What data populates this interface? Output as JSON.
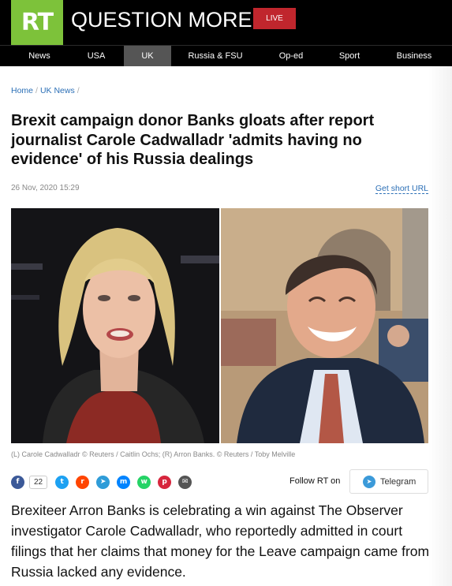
{
  "header": {
    "logo": "RT",
    "slogan": "QUESTION MORE",
    "live": "LIVE",
    "colors": {
      "brand": "#7dc23a",
      "live": "#c0262d",
      "link": "#2b6fb6"
    }
  },
  "nav": [
    {
      "label": "News",
      "active": false
    },
    {
      "label": "USA",
      "active": false
    },
    {
      "label": "UK",
      "active": true
    },
    {
      "label": "Russia & FSU",
      "active": false
    },
    {
      "label": "Op-ed",
      "active": false
    },
    {
      "label": "Sport",
      "active": false
    },
    {
      "label": "Business",
      "active": false
    }
  ],
  "breadcrumb": {
    "home": "Home",
    "section": "UK News"
  },
  "article": {
    "headline": "Brexit campaign donor Banks gloats after report journalist Carole Cadwalladr 'admits having no evidence' of his Russia dealings",
    "date": "26 Nov, 2020 15:29",
    "short_url": "Get short URL",
    "caption": "(L) Carole Cadwalladr © Reuters / Caitlin Ochs; (R) Arron Banks. © Reuters / Toby Melville",
    "body": "Brexiteer Arron Banks is celebrating a win against The Observer investigator Carole Cadwalladr, who reportedly admitted in court filings that her claims that money for the Leave campaign came from Russia lacked any evidence."
  },
  "share": {
    "count": "22",
    "icons": [
      {
        "name": "facebook-icon",
        "color": "#3b5998",
        "glyph": "f"
      },
      {
        "name": "twitter-icon",
        "color": "#1da1f2",
        "glyph": "t"
      },
      {
        "name": "reddit-icon",
        "color": "#ff4500",
        "glyph": "r"
      },
      {
        "name": "telegram-share-icon",
        "color": "#2f9cd8",
        "glyph": "➤"
      },
      {
        "name": "messenger-icon",
        "color": "#0084ff",
        "glyph": "m"
      },
      {
        "name": "whatsapp-icon",
        "color": "#25d366",
        "glyph": "w"
      },
      {
        "name": "pocket-icon",
        "color": "#d7263d",
        "glyph": "p"
      },
      {
        "name": "email-icon",
        "color": "#555555",
        "glyph": "✉"
      }
    ],
    "follow": "Follow RT on",
    "telegram": "Telegram"
  }
}
